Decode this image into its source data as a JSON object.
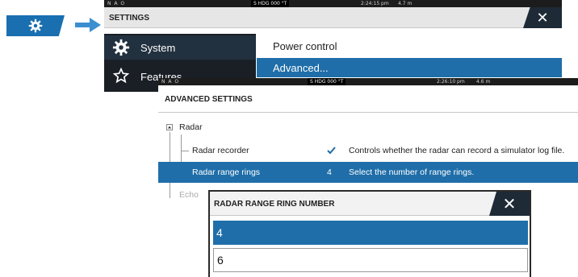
{
  "nav": {
    "icon": "gear-icon",
    "arrow_icon": "arrow-right-icon"
  },
  "settings": {
    "status": {
      "left": "N A O",
      "hdg": "S HDG 000 °T",
      "time": "2:24:15 pm",
      "range": "4.7 m"
    },
    "title": "SETTINGS",
    "close_label": "✕",
    "sidebar": [
      {
        "label": "System",
        "icon": "gear-icon",
        "selected": true
      },
      {
        "label": "Features",
        "icon": "star-icon",
        "selected": false
      }
    ],
    "menu": [
      {
        "label": "Power control",
        "selected": false
      },
      {
        "label": "Advanced...",
        "selected": true
      }
    ]
  },
  "advanced": {
    "status": {
      "left": "N A O",
      "hdg": "S HDG 000 °T",
      "time": "2:26:10 pm",
      "range": "4.6 m"
    },
    "title": "ADVANCED SETTINGS",
    "group": "Radar",
    "rows": [
      {
        "label": "Radar recorder",
        "value_icon": "checkmark-icon",
        "description": "Controls whether the radar can record a simulator log file.",
        "selected": false
      },
      {
        "label": "Radar range rings",
        "value": "4",
        "description": "Select the number of range rings.",
        "selected": true
      }
    ],
    "next_group_partial": "Echo"
  },
  "dialog": {
    "title": "RADAR RANGE RING NUMBER",
    "close_label": "✕",
    "options": [
      {
        "label": "4",
        "selected": true
      },
      {
        "label": "6",
        "selected": false
      }
    ]
  },
  "colors": {
    "accent": "#1f6ea9",
    "nav_blue": "#1a6fb0",
    "dark": "#1a1f26",
    "title_bg": "#e6e6e6"
  }
}
